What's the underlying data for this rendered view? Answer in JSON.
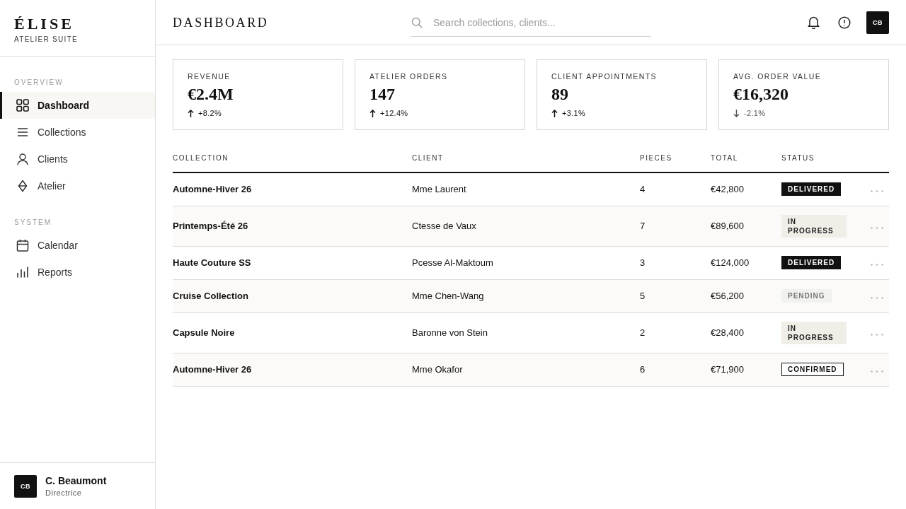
{
  "sidebar": {
    "brand": {
      "name": "ÉLISE",
      "tagline": "ATELIER SUITE"
    },
    "sections": [
      {
        "label": "OVERVIEW",
        "items": [
          {
            "label": "Dashboard",
            "selected": true
          },
          {
            "label": "Collections",
            "selected": false
          },
          {
            "label": "Clients",
            "selected": false
          },
          {
            "label": "Atelier",
            "selected": false
          }
        ]
      },
      {
        "label": "SYSTEM",
        "items": [
          {
            "label": "Calendar",
            "selected": false
          },
          {
            "label": "Reports",
            "selected": false
          }
        ]
      }
    ],
    "user": {
      "initials": "CB",
      "name": "C. Beaumont",
      "role": "Directrice"
    }
  },
  "header": {
    "title": "DASHBOARD",
    "search": {
      "placeholder": "Search collections, clients..."
    },
    "avatar": {
      "initials": "CB"
    }
  },
  "metrics": [
    {
      "label": "REVENUE",
      "value": "€2.4M",
      "change": "+8.2%",
      "kind": "rise"
    },
    {
      "label": "ATELIER ORDERS",
      "value": "147",
      "change": "+12.4%",
      "kind": "rise"
    },
    {
      "label": "CLIENT APPOINTMENTS",
      "value": "89",
      "change": "+3.1%",
      "kind": "rise"
    },
    {
      "label": "AVG. ORDER VALUE",
      "value": "€16,320",
      "change": "-2.1%",
      "kind": "fall"
    }
  ],
  "table": {
    "columns": [
      "COLLECTION",
      "CLIENT",
      "PIECES",
      "TOTAL",
      "STATUS"
    ],
    "rows": [
      {
        "collection": "Automne-Hiver 26",
        "client": "Mme Laurent",
        "pieces": "4",
        "total": "€42,800",
        "status": {
          "label": "DELIVERED",
          "kind": "delivered"
        }
      },
      {
        "collection": "Printemps-Été 26",
        "client": "Ctesse de Vaux",
        "pieces": "7",
        "total": "€89,600",
        "status": {
          "label": "IN PROGRESS",
          "kind": "in_progress"
        }
      },
      {
        "collection": "Haute Couture SS",
        "client": "Pcesse Al-Maktoum",
        "pieces": "3",
        "total": "€124,000",
        "status": {
          "label": "DELIVERED",
          "kind": "delivered"
        }
      },
      {
        "collection": "Cruise Collection",
        "client": "Mme Chen-Wang",
        "pieces": "5",
        "total": "€56,200",
        "status": {
          "label": "PENDING",
          "kind": "pending"
        }
      },
      {
        "collection": "Capsule Noire",
        "client": "Baronne von Stein",
        "pieces": "2",
        "total": "€28,400",
        "status": {
          "label": "IN PROGRESS",
          "kind": "in_progress"
        }
      },
      {
        "collection": "Automne-Hiver 26",
        "client": "Mme Okafor",
        "pieces": "6",
        "total": "€71,900",
        "status": {
          "label": "CONFIRMED",
          "kind": "confirmed"
        }
      }
    ]
  }
}
